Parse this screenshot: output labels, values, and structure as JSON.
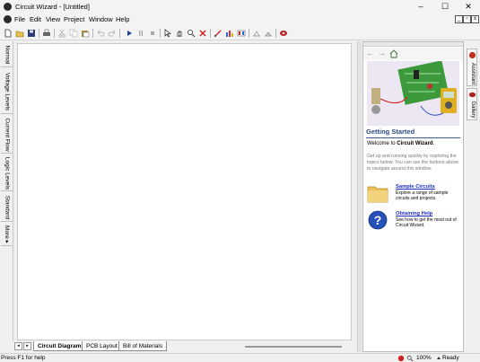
{
  "window": {
    "title": "Circuit Wizard - [Untitled]",
    "minimize_glyph": "–",
    "maximize_glyph": "☐",
    "close_glyph": "✕"
  },
  "menu": {
    "items": [
      "File",
      "Edit",
      "View",
      "Project",
      "Window",
      "Help"
    ],
    "mdi_minimize": "_",
    "mdi_restore": "▫",
    "mdi_close": "x"
  },
  "toolbar": {
    "icons": [
      "new-icon",
      "open-icon",
      "save-icon",
      "print-icon",
      "cut-icon",
      "copy-icon",
      "paste-icon",
      "undo-icon",
      "redo-icon",
      "play-icon",
      "pause-icon",
      "stop-icon",
      "pointer-icon",
      "pan-icon",
      "zoom-icon",
      "delete-icon",
      "probe-icon",
      "graph-icon",
      "components-icon",
      "analysis-icon",
      "pcb-icon",
      "record-icon"
    ]
  },
  "left_tabs": [
    "Normal",
    "Voltage Levels",
    "Current Flow",
    "Logic Levels",
    "Standard",
    "More ▸"
  ],
  "doc_tabs": {
    "nav_prev": "◂",
    "nav_next": "▸",
    "tabs": [
      "Circuit Diagram",
      "PCB Layout",
      "Bill of Materials"
    ],
    "active": 0
  },
  "assistant": {
    "getting_started_title": "Getting Started",
    "welcome_prefix": "Welcome to ",
    "welcome_app": "Circuit Wizard",
    "welcome_suffix": ".",
    "intro": "Get up and running quickly by exploring the topics below. You can use the buttons above to navigate around this window.",
    "links": [
      {
        "title": "Sample Circuits",
        "desc": "Explore a range of sample circuits and projects.",
        "icon": "folder-icon"
      },
      {
        "title": "Obtaining Help",
        "desc": "See how to get the most out of Circuit Wizard.",
        "icon": "help-icon"
      }
    ]
  },
  "side_tabs": [
    "Assistant",
    "Gallery"
  ],
  "status": {
    "left": "Press F1 for help",
    "zoom": "100%",
    "ready": "Ready"
  },
  "colors": {
    "accent_title": "#2b4a86",
    "link": "#1c2fc1"
  }
}
